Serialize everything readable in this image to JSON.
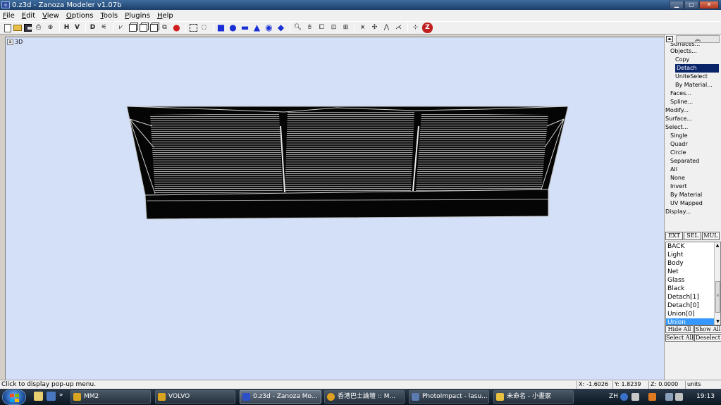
{
  "window": {
    "title": "0.z3d - Zanoza Modeler v1.07b",
    "icon_label": "ZM"
  },
  "menu": [
    {
      "label": "File",
      "accel": "F",
      "rest": "ile"
    },
    {
      "label": "Edit",
      "accel": "E",
      "rest": "dit"
    },
    {
      "label": "View",
      "accel": "V",
      "rest": "iew"
    },
    {
      "label": "Options",
      "accel": "O",
      "rest": "ptions"
    },
    {
      "label": "Tools",
      "accel": "T",
      "rest": "ools"
    },
    {
      "label": "Plugins",
      "accel": "P",
      "rest": "lugins"
    },
    {
      "label": "Help",
      "accel": "H",
      "rest": "elp"
    }
  ],
  "toolbar": {
    "h_label": "H",
    "v_label": "V",
    "d_label": "D"
  },
  "viewport": {
    "label": "3D"
  },
  "panel": {
    "tree": [
      {
        "label": "Surfaces...",
        "level": 1,
        "state": "cut"
      },
      {
        "label": "Objects...",
        "level": 1
      },
      {
        "label": "Copy",
        "level": 2
      },
      {
        "label": "Detach",
        "level": 2,
        "state": "selected"
      },
      {
        "label": "UniteSelect",
        "level": 2
      },
      {
        "label": "By Material...",
        "level": 2
      },
      {
        "label": "Faces...",
        "level": 1
      },
      {
        "label": "Spline...",
        "level": 1
      },
      {
        "label": "Modify...",
        "level": 0
      },
      {
        "label": "Surface...",
        "level": 0
      },
      {
        "label": "Select...",
        "level": 0
      },
      {
        "label": "Single",
        "level": 1
      },
      {
        "label": "Quadr",
        "level": 1
      },
      {
        "label": "Circle",
        "level": 1
      },
      {
        "label": "Separated",
        "level": 1
      },
      {
        "label": "All",
        "level": 1
      },
      {
        "label": "None",
        "level": 1
      },
      {
        "label": "Invert",
        "level": 1
      },
      {
        "label": "By Material",
        "level": 1
      },
      {
        "label": "UV Mapped",
        "level": 1
      },
      {
        "label": "Display...",
        "level": 0
      }
    ],
    "modes": [
      "EXT",
      "SEL",
      "MUL"
    ],
    "layers": [
      "BACK",
      "Light",
      "Body",
      "Net",
      "Glass",
      "Black",
      "Detach[1]",
      "Detach[0]",
      "Union[0]",
      "Union"
    ],
    "selected_layer": "Union",
    "buttons": {
      "hide_all": "Hide All",
      "show_all": "Show All",
      "select_all": "Select All",
      "deselect": "Deselect"
    }
  },
  "status": {
    "message": "Click to display pop-up menu.",
    "x_label": "X:",
    "x_value": "-1.6026",
    "y_label": "Y:",
    "y_value": "1.8239",
    "z_label": "Z:",
    "z_value": "0.0000",
    "units": "units"
  },
  "taskbar": {
    "tasks": [
      {
        "label": "MM2",
        "color": "#d9a520"
      },
      {
        "label": "VOLVO",
        "color": "#d9a520"
      },
      {
        "label": "0.z3d - Zanoza Mo...",
        "color": "#2d50c8",
        "active": true
      },
      {
        "label": "香港巴士論壇 :: M...",
        "color": "#e0a020"
      },
      {
        "label": "PhotoImpact - lasu...",
        "color": "#5a7ab0"
      },
      {
        "label": "未命名 - 小畫家",
        "color": "#e8c040"
      }
    ],
    "lang": "ZH",
    "clock": "19:13"
  }
}
